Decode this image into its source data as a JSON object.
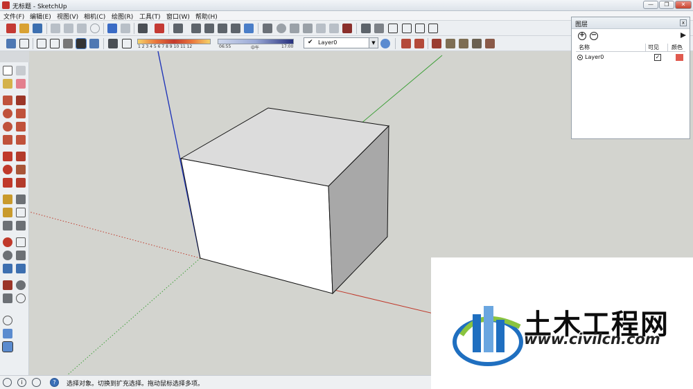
{
  "window": {
    "title": "无标题 - SketchUp",
    "minimize": "—",
    "maximize": "❐",
    "close": "✕"
  },
  "menu": [
    "文件(F)",
    "编辑(E)",
    "视图(V)",
    "相机(C)",
    "绘图(R)",
    "工具(T)",
    "窗口(W)",
    "帮助(H)"
  ],
  "shadow_settings": {
    "month_ticks": "1 2 3 4 5 6 7 8 9 10 11 12",
    "time_start": "06:55",
    "time_mid": "中午",
    "time_end": "17:00"
  },
  "layer_toolbar": {
    "current_layer": "Layer0"
  },
  "layers_panel": {
    "title": "图层",
    "add_symbol": "+",
    "remove_symbol": "−",
    "close": "x",
    "columns": {
      "name": "名称",
      "visible": "可见",
      "color": "颜色"
    },
    "rows": [
      {
        "name": "Layer0",
        "visible": true,
        "color": "#e05a4f"
      }
    ]
  },
  "status": {
    "message": "选择对象。切换到扩充选择。拖动鼠标选择多项。",
    "help_symbol": "?",
    "info_symbol": "i"
  },
  "watermark": {
    "name": "土木工程网",
    "url": "www.civilcn.com"
  },
  "colors": {
    "x_axis": "#c0392b",
    "y_axis": "#3fa03a",
    "z_axis": "#2237b8",
    "cube_top": "#dcdcdc",
    "cube_front": "#ffffff",
    "cube_side": "#a8a8a8"
  }
}
